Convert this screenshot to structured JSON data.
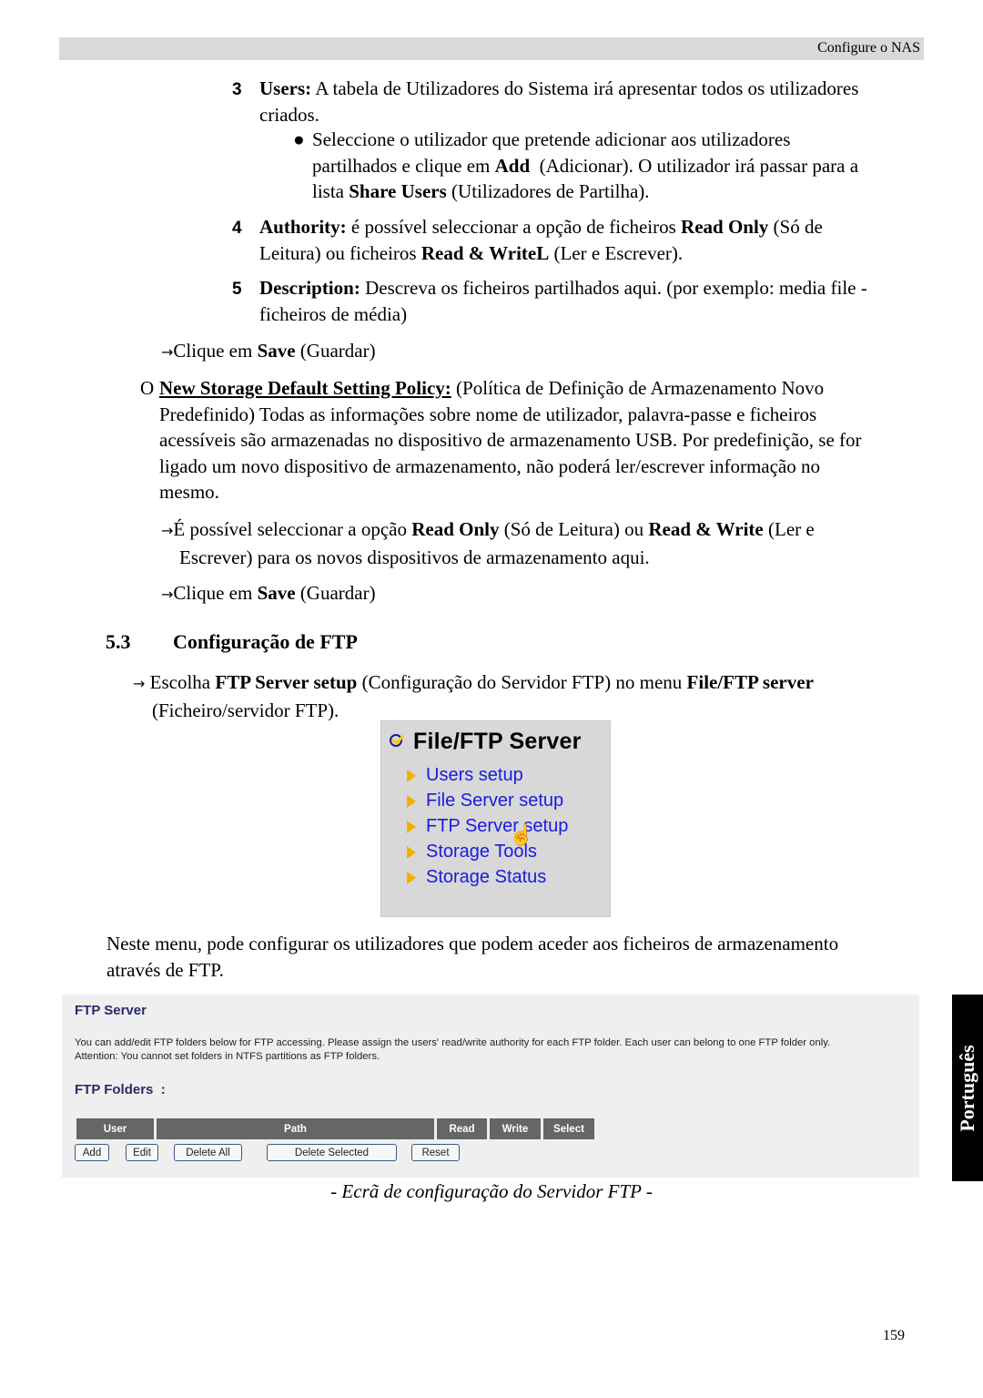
{
  "header": {
    "title": "Configure o NAS"
  },
  "items": {
    "users": {
      "number": "3",
      "label": "Users:",
      "text": " A tabela de Utilizadores do Sistema irá apresentar todos os utilizadores",
      "text2": "criados.",
      "bullet": "●",
      "bullet_l1": "Seleccione o utilizador que pretende adicionar aos utilizadores",
      "bullet_l2_a": "partilhados e clique em ",
      "bullet_l2_b": "Add",
      "bullet_l2_c": "  (Adicionar). O utilizador irá passar para a",
      "bullet_l3_a": "lista ",
      "bullet_l3_b": "Share Users",
      "bullet_l3_c": " (Utilizadores de Partilha)."
    },
    "authority": {
      "number": "4",
      "label": "Authority:",
      "text_a": " é possível seleccionar a opção de ficheiros ",
      "text_b": "Read Only",
      "text_c": " (Só de",
      "l2_a": "Leitura) ou ficheiros ",
      "l2_b": "Read & WriteL",
      "l2_c": " (Ler e Escrever)."
    },
    "description": {
      "number": "5",
      "label": "Description:",
      "text": " Descreva os ficheiros partilhados aqui. (por exemplo: media file -",
      "text2": "ficheiros de média)"
    }
  },
  "save1": {
    "arrow": "→",
    "a": "Clique em ",
    "b": "Save",
    "c": " (Guardar)"
  },
  "policy": {
    "bullet": "O",
    "label": "New Storage Default Setting Policy:",
    "l1": " (Política de Definição de Armazenamento Novo",
    "l2": "Predefinido) Todas as informações sobre nome de utilizador, palavra-passe e ficheiros",
    "l3": "acessíveis são armazenadas no dispositivo de armazenamento USB. Por predefinição, se for",
    "l4": "ligado um novo dispositivo de armazenamento, não poderá ler/escrever informação no",
    "l5": "mesmo.",
    "opt_arrow": "→",
    "opt_a": "É possível seleccionar a opção ",
    "opt_b": "Read Only",
    "opt_c": " (Só de Leitura) ou ",
    "opt_d": "Read & Write",
    "opt_e": " (Ler e",
    "opt_l2": "Escrever) para os novos dispositivos de armazenamento aqui."
  },
  "save2": {
    "arrow": "→",
    "a": "Clique em ",
    "b": "Save",
    "c": " (Guardar)"
  },
  "section": {
    "number": "5.3",
    "title": "Configuração de FTP"
  },
  "choose": {
    "arrow": "→",
    "a": " Escolha ",
    "b": "FTP Server setup",
    "c": " (Configuração do Servidor FTP) no menu ",
    "d": "File/FTP server",
    "l2": "(Ficheiro/servidor FTP)."
  },
  "menu": {
    "title": "File/FTP Server",
    "items": [
      "Users setup",
      "File Server setup",
      "FTP Server setup",
      "Storage Tools",
      "Storage Status"
    ],
    "cursor": "☝"
  },
  "intro": {
    "l1": "Neste menu, pode configurar os utilizadores que podem aceder aos ficheiros de armazenamento",
    "l2": "através de FTP."
  },
  "ftp": {
    "title": "FTP Server",
    "desc1": "You can add/edit FTP folders below for FTP accessing. Please assign the users' read/write authority for each FTP folder. Each user can belong to one FTP folder only.",
    "desc2": "Attention: You cannot set folders in NTFS partitions as FTP folders.",
    "folders_title": "FTP Folders  :",
    "columns": [
      "User",
      "Path",
      "Read",
      "Write",
      "Select"
    ],
    "buttons": [
      "Add",
      "Edit",
      "Delete All",
      "Delete Selected",
      "Reset"
    ]
  },
  "caption": "- Ecrã de configuração do Servidor FTP -",
  "side_tab": "Português",
  "page_number": "159"
}
